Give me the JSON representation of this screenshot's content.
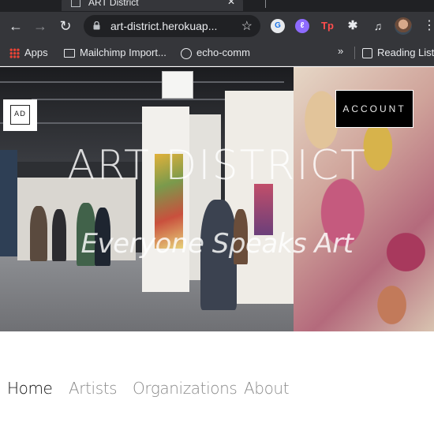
{
  "browser": {
    "tab_title": "ART District",
    "url": "art-district.herokuap...",
    "bookmarks": [
      {
        "label": "Apps",
        "icon": "apps-grid-icon"
      },
      {
        "label": "Mailchimp Import...",
        "icon": "folder-icon"
      },
      {
        "label": "echo-comm",
        "icon": "globe-icon"
      }
    ],
    "reading_list": "Reading List"
  },
  "site": {
    "logo_text": "AD",
    "account_label": "ACCOUNT",
    "title": "ART DISTRICT",
    "subtitle": "Everyone Speaks Art",
    "nav": [
      {
        "label": "Home",
        "active": true
      },
      {
        "label": "Artists",
        "active": false
      },
      {
        "label": "Organizations",
        "active": false
      },
      {
        "label": "About",
        "active": false
      }
    ]
  }
}
